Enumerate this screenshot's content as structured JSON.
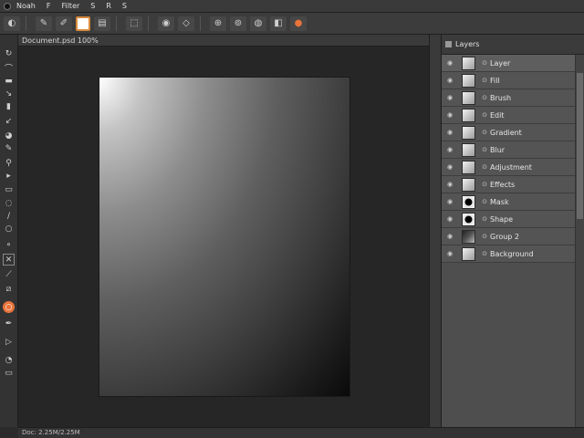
{
  "menu": {
    "items": [
      "Noah",
      "F",
      "Filter",
      "S",
      "R",
      "S"
    ]
  },
  "document": {
    "tab_title": "Document.psd 100%"
  },
  "panel": {
    "title": "Layers"
  },
  "layers": [
    {
      "name": "Layer",
      "thumb": "light",
      "selected": true
    },
    {
      "name": "Fill",
      "thumb": "light",
      "selected": false
    },
    {
      "name": "Brush",
      "thumb": "light",
      "selected": false
    },
    {
      "name": "Edit",
      "thumb": "light",
      "selected": false
    },
    {
      "name": "Gradient",
      "thumb": "light",
      "selected": false
    },
    {
      "name": "Blur",
      "thumb": "light",
      "selected": false
    },
    {
      "name": "Adjustment",
      "thumb": "light",
      "selected": false
    },
    {
      "name": "Effects",
      "thumb": "light",
      "selected": false
    },
    {
      "name": "Mask",
      "thumb": "dark",
      "selected": false
    },
    {
      "name": "Shape",
      "thumb": "dark",
      "selected": false
    },
    {
      "name": "Group 2",
      "thumb": "mixed",
      "selected": false
    },
    {
      "name": "Background",
      "thumb": "light",
      "selected": false
    }
  ],
  "status": {
    "text": "Doc: 2.25M/2.25M"
  },
  "colors": {
    "accent": "#e8733b",
    "canvas_bg": "#262626",
    "panel_bg": "#4e4e4e"
  }
}
